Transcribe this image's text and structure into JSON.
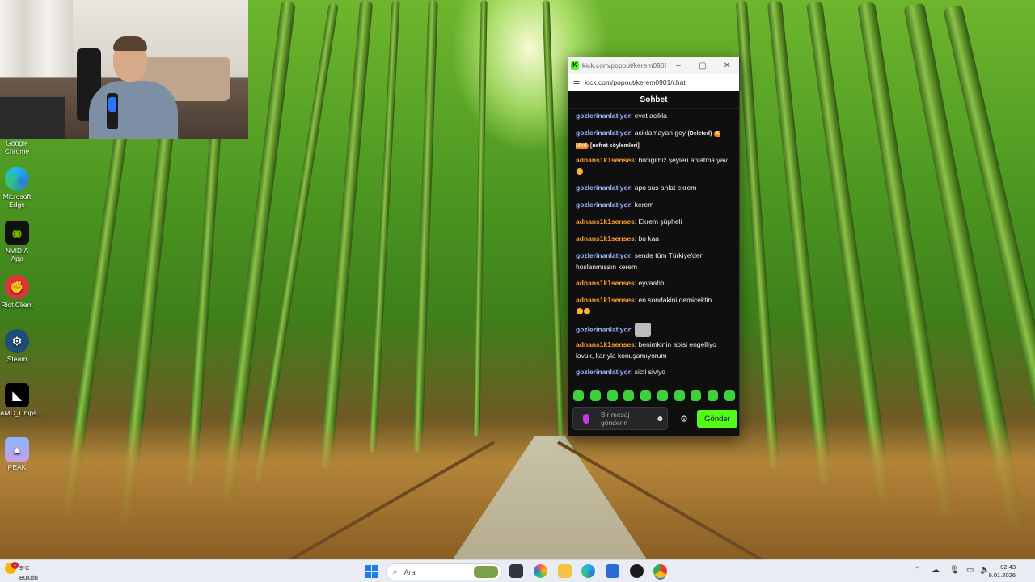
{
  "desktop": {
    "icons": [
      {
        "label": "Google Chrome",
        "icon": "chrome-icon"
      },
      {
        "label": "Microsoft Edge",
        "icon": "edge-icon"
      },
      {
        "label": "NVIDIA App",
        "icon": "nvidia-icon"
      },
      {
        "label": "Riot Client",
        "icon": "riot-icon"
      },
      {
        "label": "Steam",
        "icon": "steam-icon"
      },
      {
        "label": "AMD_Chips...",
        "icon": "amd-icon"
      },
      {
        "label": "PEAK",
        "icon": "peak-icon"
      }
    ]
  },
  "window": {
    "title": "kick.com/popout/kerem0901...",
    "url": "kick.com/popout/kerem0901/chat",
    "minimize": "–",
    "maximize": "▢",
    "close": "✕"
  },
  "chat": {
    "header": "Sohbet",
    "messages": [
      {
        "user": "gozlerinanlatiyor",
        "text": " evet acikla"
      },
      {
        "user": "gozlerinanlatiyor",
        "text": " aciklamayan gey",
        "deleted": "(Deleted)",
        "badge": "AI Mod",
        "reason": "[nefret söylemleri]"
      },
      {
        "user": "adnans1k1senses",
        "text": " bildiğimiz şeyleri anlatma yav"
      },
      {
        "user": "gozlerinanlatiyor",
        "text": " apo sus anlat ekrem"
      },
      {
        "user": "gozlerinanlatiyor",
        "text": " kerem"
      },
      {
        "user": "adnans1k1senses",
        "text": " Ekrem şüpheli"
      },
      {
        "user": "adnans1k1senses",
        "text": " bu kaa"
      },
      {
        "user": "gozlerinanlatiyor",
        "text": " sende tüm Türkiye'den hoslanmıssın kerem"
      },
      {
        "user": "adnans1k1senses",
        "text": " eyvaahh"
      },
      {
        "user": "adnans1k1senses",
        "text": " en sondakini demicektin"
      },
      {
        "user": "gozlerinanlatiyor",
        "text": " "
      },
      {
        "user": "adnans1k1senses",
        "text": " benimkinin abisi engelliyo lavuk, karıyla konuşamıyorum"
      },
      {
        "user": "gozlerinanlatiyor",
        "text": " sicti siviyo"
      }
    ],
    "input_placeholder": "Bir mesaj gönderin",
    "send_label": "Gönder"
  },
  "taskbar": {
    "weather_temp": "9°C",
    "weather_desc": "Bulutlu",
    "notification_count": "1",
    "search_placeholder": "Ara",
    "time": "02:43",
    "date": "9.01.2026"
  }
}
